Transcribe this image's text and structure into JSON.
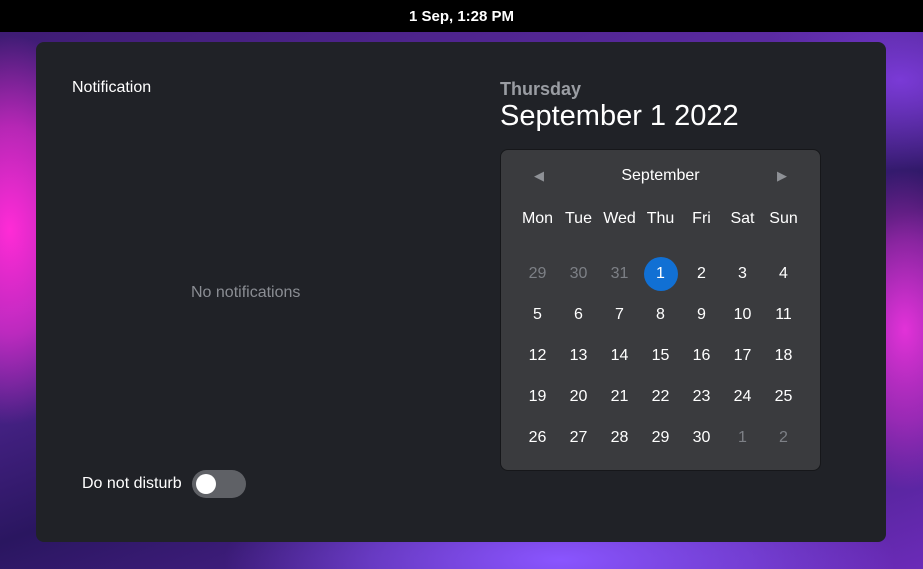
{
  "topbar": {
    "clock": "1 Sep, 1:28 PM"
  },
  "notifications": {
    "title": "Notification",
    "empty_text": "No notifications",
    "dnd_label": "Do not disturb",
    "dnd_enabled": false
  },
  "date": {
    "day_name": "Thursday",
    "full_date": "September 1 2022"
  },
  "calendar": {
    "month": "September",
    "prev_icon": "◀",
    "next_icon": "▶",
    "weekdays": [
      "Mon",
      "Tue",
      "Wed",
      "Thu",
      "Fri",
      "Sat",
      "Sun"
    ],
    "weeks": [
      [
        {
          "d": "29",
          "m": true
        },
        {
          "d": "30",
          "m": true
        },
        {
          "d": "31",
          "m": true
        },
        {
          "d": "1",
          "t": true
        },
        {
          "d": "2"
        },
        {
          "d": "3"
        },
        {
          "d": "4"
        }
      ],
      [
        {
          "d": "5"
        },
        {
          "d": "6"
        },
        {
          "d": "7"
        },
        {
          "d": "8"
        },
        {
          "d": "9"
        },
        {
          "d": "10"
        },
        {
          "d": "11"
        }
      ],
      [
        {
          "d": "12"
        },
        {
          "d": "13"
        },
        {
          "d": "14"
        },
        {
          "d": "15"
        },
        {
          "d": "16"
        },
        {
          "d": "17"
        },
        {
          "d": "18"
        }
      ],
      [
        {
          "d": "19"
        },
        {
          "d": "20"
        },
        {
          "d": "21"
        },
        {
          "d": "22"
        },
        {
          "d": "23"
        },
        {
          "d": "24"
        },
        {
          "d": "25"
        }
      ],
      [
        {
          "d": "26"
        },
        {
          "d": "27"
        },
        {
          "d": "28"
        },
        {
          "d": "29"
        },
        {
          "d": "30"
        },
        {
          "d": "1",
          "m": true
        },
        {
          "d": "2",
          "m": true
        }
      ]
    ],
    "accent_color": "#1170d4"
  }
}
